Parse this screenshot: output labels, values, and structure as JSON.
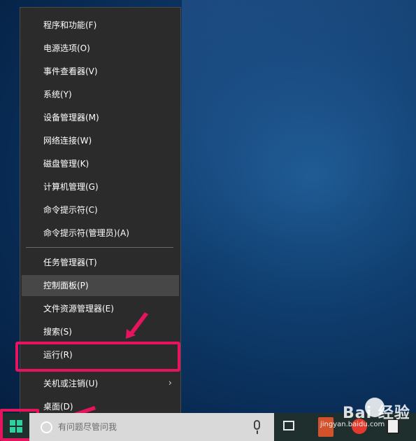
{
  "context_menu": {
    "items_top": [
      {
        "label": "程序和功能(F)"
      },
      {
        "label": "电源选项(O)"
      },
      {
        "label": "事件查看器(V)"
      },
      {
        "label": "系统(Y)"
      },
      {
        "label": "设备管理器(M)"
      },
      {
        "label": "网络连接(W)"
      },
      {
        "label": "磁盘管理(K)"
      },
      {
        "label": "计算机管理(G)"
      },
      {
        "label": "命令提示符(C)"
      },
      {
        "label": "命令提示符(管理员)(A)"
      }
    ],
    "items_bottom": [
      {
        "label": "任务管理器(T)"
      },
      {
        "label": "控制面板(P)",
        "hovered": true
      },
      {
        "label": "文件资源管理器(E)"
      },
      {
        "label": "搜索(S)"
      },
      {
        "label": "运行(R)",
        "highlighted": true
      },
      {
        "label": "关机或注销(U)",
        "has_submenu": true
      },
      {
        "label": "桌面(D)"
      }
    ],
    "submenu_arrow": "›"
  },
  "taskbar": {
    "search_placeholder": "有问题尽管问我",
    "icons": [
      "start-icon",
      "search-circle-icon",
      "microphone-icon",
      "task-view-icon",
      "app-icon",
      "app-icon",
      "calculator-icon"
    ]
  },
  "annotations": {
    "highlight_color": "#e6135f"
  },
  "watermark": {
    "brand": "Bai 经验",
    "url": "jingyan.baidu.com"
  },
  "colors": {
    "menu_bg": "#2b2b2b",
    "menu_hover": "#474747",
    "taskbar_bg": "#1e2f2e",
    "accent": "#2fd0a0"
  }
}
